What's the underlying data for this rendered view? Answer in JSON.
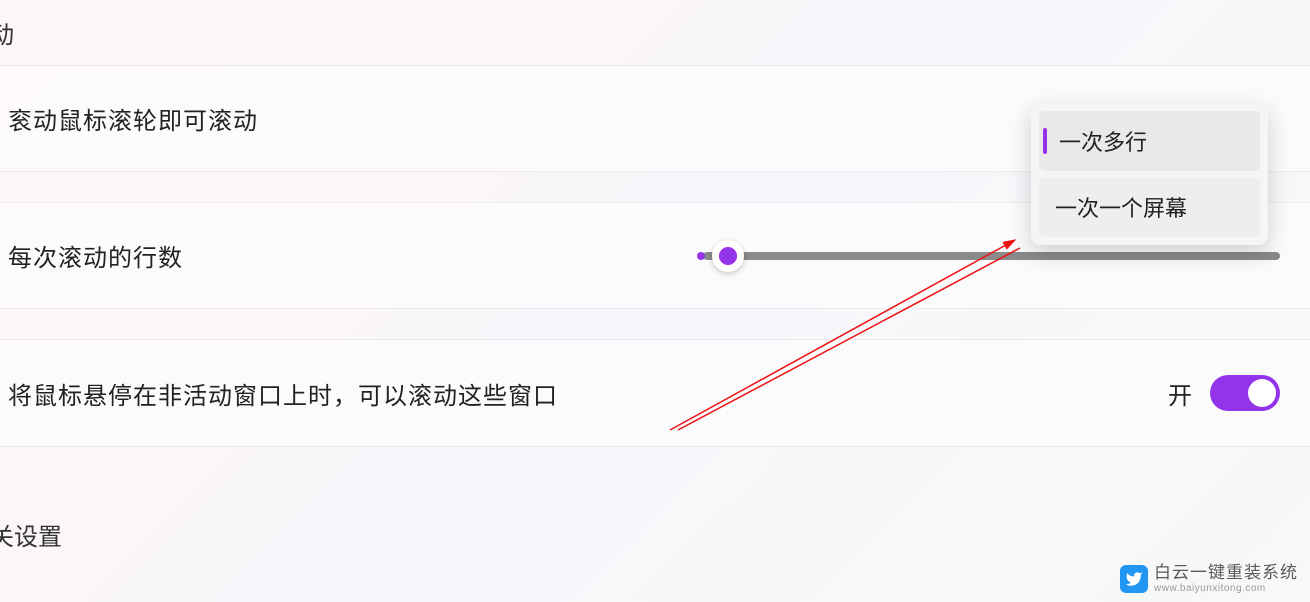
{
  "section": {
    "header": "动"
  },
  "scrollMode": {
    "label": "衮动鼠标滚轮即可滚动",
    "options": {
      "multiLine": "一次多行",
      "oneScreen": "一次一个屏幕"
    }
  },
  "linesPerScroll": {
    "label": "每次滚动的行数"
  },
  "hoverScroll": {
    "label": "将鼠标悬停在非活动窗口上时，可以滚动这些窗口",
    "state": "开"
  },
  "relatedSettings": {
    "header": "关设置"
  },
  "watermark": {
    "main": "白云一键重装系统",
    "sub": "www.baiyunxitong.com"
  },
  "colors": {
    "accent": "#9333ea",
    "brandBlue": "#2196f3"
  }
}
